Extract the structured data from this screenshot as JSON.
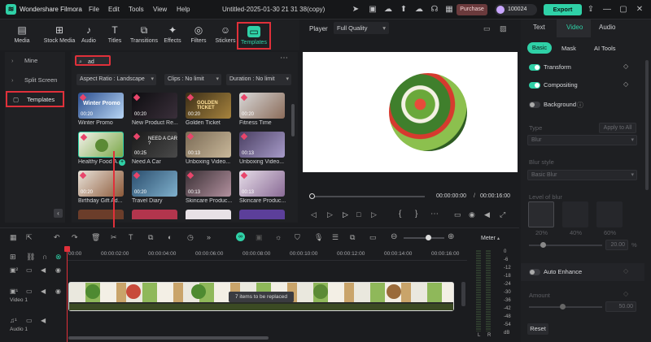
{
  "app": {
    "name": "Wondershare Filmora",
    "project_title": "Untitled-2025-01-30 21 31 38(copy)"
  },
  "menu": [
    "File",
    "Edit",
    "Tools",
    "View",
    "Help"
  ],
  "topbar": {
    "purchase": "Purchase",
    "credits": "100024",
    "export": "Export"
  },
  "media_tabs": [
    "Media",
    "Stock Media",
    "Audio",
    "Titles",
    "Transitions",
    "Effects",
    "Filters",
    "Stickers",
    "Templates"
  ],
  "sidebar": {
    "items": [
      "Mine",
      "Split Screen",
      "Templates"
    ]
  },
  "search": {
    "value": "ad"
  },
  "filters": {
    "aspect": "Aspect Ratio : Landscape",
    "clips": "Clips : No limit",
    "duration": "Duration : No limit"
  },
  "templates": [
    {
      "label": "Winter Promo",
      "duration": "00:20",
      "overlay": "Winter Promo"
    },
    {
      "label": "New Product Re...",
      "duration": "00:20",
      "overlay": ""
    },
    {
      "label": "Golden Ticket",
      "duration": "00:20",
      "overlay": "GOLDEN TICKET"
    },
    {
      "label": "Fitness Time",
      "duration": "00:20",
      "overlay": ""
    },
    {
      "label": "Healthy Food A...",
      "duration": "",
      "overlay": ""
    },
    {
      "label": "Need A Car",
      "duration": "00:25",
      "overlay": "NEED A CAR ?"
    },
    {
      "label": "Unboxing Video...",
      "duration": "00:13",
      "overlay": ""
    },
    {
      "label": "Unboxing Video...",
      "duration": "00:13",
      "overlay": ""
    },
    {
      "label": "Birthday Gift Ad...",
      "duration": "00:20",
      "overlay": ""
    },
    {
      "label": "Travel Diary",
      "duration": "00:20",
      "overlay": ""
    },
    {
      "label": "Skincare Produc...",
      "duration": "00:13",
      "overlay": ""
    },
    {
      "label": "Skincare Produc...",
      "duration": "00:13",
      "overlay": ""
    }
  ],
  "player": {
    "label": "Player",
    "quality": "Full Quality",
    "current_time": "00:00:00:00",
    "total_time": "00:00:16:00"
  },
  "right_panel": {
    "tabs": [
      "Text",
      "Video",
      "Audio"
    ],
    "subtabs": [
      "Basic",
      "Mask",
      "AI Tools"
    ],
    "transform": "Transform",
    "compositing": "Compositing",
    "background": "Background",
    "type_label": "Type",
    "apply_all": "Apply to All",
    "type_value": "Blur",
    "blur_style_label": "Blur style",
    "blur_style_value": "Basic Blur",
    "blur_level_label": "Level of blur",
    "blur_levels": [
      "20%",
      "40%",
      "60%"
    ],
    "blur_value": "20.00",
    "blur_unit": "%",
    "auto_enhance": "Auto Enhance",
    "amount_label": "Amount",
    "amount_value": "50.00",
    "reset": "Reset"
  },
  "timeline": {
    "ticks": [
      "00:00",
      "00:00:02:00",
      "00:00:04:00",
      "00:00:06:00",
      "00:00:08:00",
      "00:00:10:00",
      "00:00:12:00",
      "00:00:14:00",
      "00:00:16:00"
    ],
    "tooltip": "7 items to be replaced",
    "video_track": "Video 1",
    "audio_track": "Audio 1",
    "meter_label": "Meter",
    "meter_scale": [
      "0",
      "-6",
      "-12",
      "-18",
      "-24",
      "-30",
      "-36",
      "-42",
      "-48",
      "-54",
      "dB"
    ],
    "meter_lr": [
      "L",
      "R"
    ]
  },
  "colors": {
    "accent": "#2fd1a7",
    "highlight": "#e0303a",
    "purchase": "#6a3a3c"
  }
}
